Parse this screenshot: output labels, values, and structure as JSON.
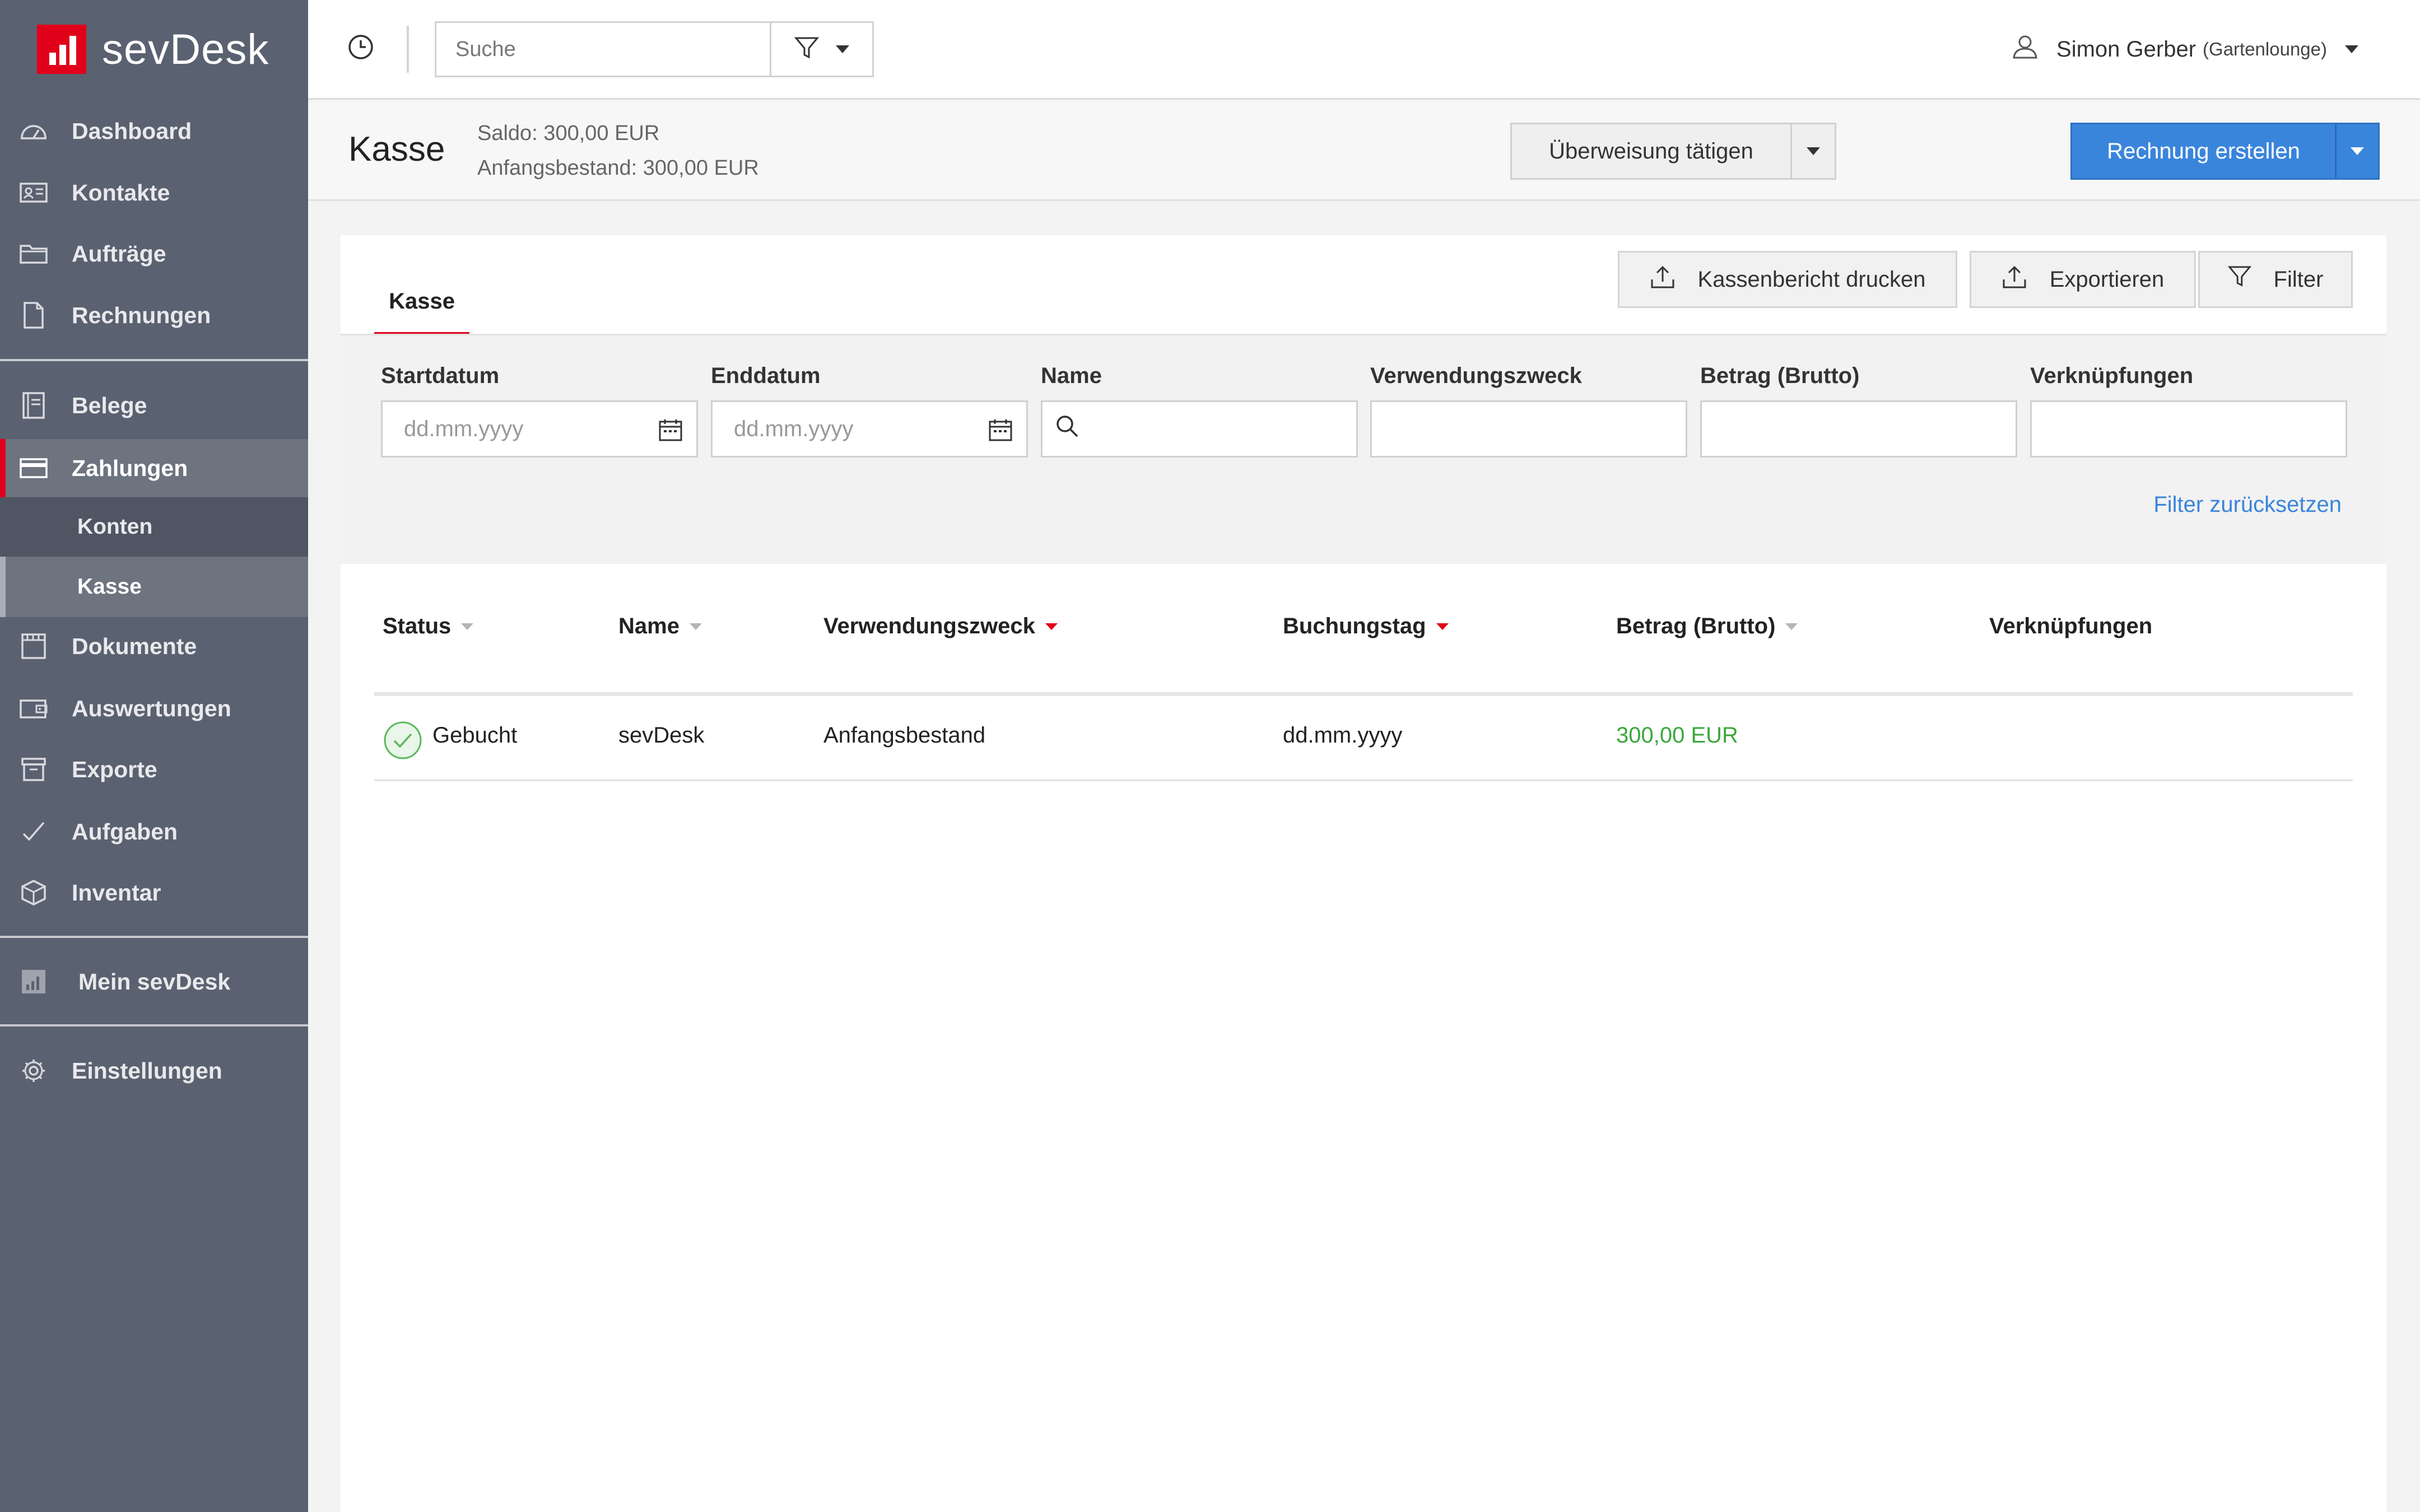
{
  "app": {
    "logo_text": "sevDesk",
    "brand_color": "#e1001a",
    "accent_color": "#3a85dc"
  },
  "sidebar": {
    "items": [
      {
        "label": "Dashboard",
        "icon": "dashboard-icon"
      },
      {
        "label": "Kontakte",
        "icon": "contacts-icon"
      },
      {
        "label": "Aufträge",
        "icon": "folder-icon"
      },
      {
        "label": "Rechnungen",
        "icon": "document-icon"
      },
      {
        "label": "Belege",
        "icon": "receipts-icon"
      },
      {
        "label": "Zahlungen",
        "icon": "credit-card-icon"
      },
      {
        "label": "Konten",
        "icon": ""
      },
      {
        "label": "Kasse",
        "icon": ""
      },
      {
        "label": "Dokumente",
        "icon": "documents-icon"
      },
      {
        "label": "Auswertungen",
        "icon": "wallet-icon"
      },
      {
        "label": "Exporte",
        "icon": "archive-icon"
      },
      {
        "label": "Aufgaben",
        "icon": "check-icon"
      },
      {
        "label": "Inventar",
        "icon": "box-icon"
      },
      {
        "label": "Mein sevDesk",
        "icon": "bar-chart-icon"
      },
      {
        "label": "Einstellungen",
        "icon": "gear-icon"
      }
    ],
    "active": "Zahlungen",
    "active_sub": "Kasse"
  },
  "topbar": {
    "search_placeholder": "Suche",
    "user_name": "Simon Gerber",
    "user_company": "(Gartenlounge)"
  },
  "header": {
    "title": "Kasse",
    "saldo": "Saldo: 300,00 EUR",
    "anfangsbestand": "Anfangsbestand: 300,00 EUR",
    "transfer_button": "Überweisung tätigen",
    "invoice_button": "Rechnung erstellen"
  },
  "card": {
    "tab": "Kasse",
    "print_button": "Kassenbericht drucken",
    "export_button": "Exportieren",
    "filter_button": "Filter"
  },
  "filters": {
    "labels": [
      "Startdatum",
      "Enddatum",
      "Name",
      "Verwendungszweck",
      "Betrag (Brutto)",
      "Verknüpfungen"
    ],
    "start_placeholder": "dd.mm.yyyy",
    "end_placeholder": "dd.mm.yyyy",
    "reset_link": "Filter zurücksetzen"
  },
  "table": {
    "columns": [
      "Status",
      "Name",
      "Verwendungszweck",
      "Buchungstag",
      "Betrag (Brutto)",
      "Verknüpfungen"
    ],
    "rows": [
      {
        "status": "Gebucht",
        "name": "sevDesk",
        "verwendungszweck": "Anfangsbestand",
        "buchungstag": "dd.mm.yyyy",
        "betrag": "300,00 EUR",
        "verknuepfungen": ""
      }
    ]
  }
}
